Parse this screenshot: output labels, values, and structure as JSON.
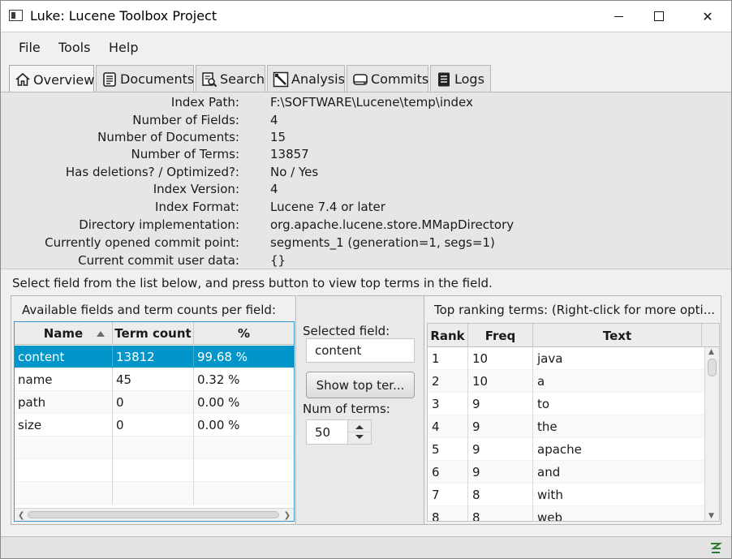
{
  "window": {
    "title": "Luke: Lucene Toolbox Project",
    "controls": {
      "minimize": "—",
      "maximize": "□",
      "close": "✕"
    }
  },
  "menu": [
    "File",
    "Tools",
    "Help"
  ],
  "tabs": [
    {
      "label": "Overview",
      "icon": "home-icon",
      "active": true
    },
    {
      "label": "Documents",
      "icon": "document-icon",
      "active": false
    },
    {
      "label": "Search",
      "icon": "search-icon",
      "active": false
    },
    {
      "label": "Analysis",
      "icon": "analysis-icon",
      "active": false
    },
    {
      "label": "Commits",
      "icon": "commits-icon",
      "active": false
    },
    {
      "label": "Logs",
      "icon": "logs-icon",
      "active": false
    }
  ],
  "overview": {
    "rows": [
      {
        "label": "Index Path:",
        "value": "F:\\SOFTWARE\\Lucene\\temp\\index"
      },
      {
        "label": "Number of Fields:",
        "value": "4"
      },
      {
        "label": "Number of Documents:",
        "value": "15"
      },
      {
        "label": "Number of Terms:",
        "value": "13857"
      },
      {
        "label": "Has deletions? / Optimized?:",
        "value": "No / Yes"
      },
      {
        "label": "Index Version:",
        "value": "4"
      },
      {
        "label": "Index Format:",
        "value": "Lucene 7.4 or later"
      },
      {
        "label": "Directory implementation:",
        "value": "org.apache.lucene.store.MMapDirectory"
      },
      {
        "label": "Currently opened commit point:",
        "value": "segments_1 (generation=1, segs=1)"
      },
      {
        "label": "Current commit user data:",
        "value": "{}"
      }
    ]
  },
  "hint": "Select field from the list below, and press button to view top terms in the field.",
  "fields_panel": {
    "caption": "Available fields and term counts per field:",
    "columns": [
      "Name",
      "Term count",
      "%"
    ],
    "rows": [
      {
        "name": "content",
        "count": "13812",
        "pct": "99.68 %",
        "selected": true
      },
      {
        "name": "name",
        "count": "45",
        "pct": "0.32 %",
        "selected": false
      },
      {
        "name": "path",
        "count": "0",
        "pct": "0.00 %",
        "selected": false
      },
      {
        "name": "size",
        "count": "0",
        "pct": "0.00 %",
        "selected": false
      }
    ]
  },
  "middle_panel": {
    "selected_label": "Selected field:",
    "selected_value": "content",
    "show_button": "Show top ter...",
    "num_label": "Num of terms:",
    "num_value": "50"
  },
  "terms_panel": {
    "caption": "Top ranking terms: (Right-click for more opti...",
    "columns": [
      "Rank",
      "Freq",
      "Text"
    ],
    "rows": [
      {
        "rank": "1",
        "freq": "10",
        "text": "java"
      },
      {
        "rank": "2",
        "freq": "10",
        "text": "a"
      },
      {
        "rank": "3",
        "freq": "9",
        "text": "to"
      },
      {
        "rank": "4",
        "freq": "9",
        "text": "the"
      },
      {
        "rank": "5",
        "freq": "9",
        "text": "apache"
      },
      {
        "rank": "6",
        "freq": "9",
        "text": "and"
      },
      {
        "rank": "7",
        "freq": "8",
        "text": "with"
      },
      {
        "rank": "8",
        "freq": "8",
        "text": "web"
      }
    ]
  },
  "colors": {
    "selection": "#0096c9",
    "table_border_active": "#3a95d3"
  }
}
